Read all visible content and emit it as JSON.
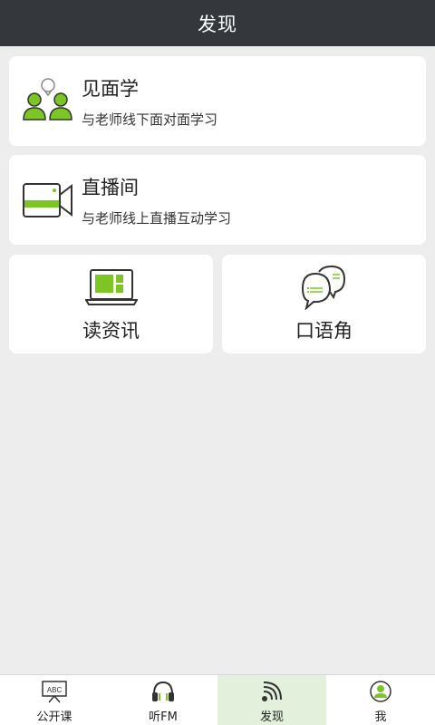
{
  "header": {
    "title": "发现"
  },
  "cards": {
    "meet": {
      "title": "见面学",
      "subtitle": "与老师线下面对面学习",
      "icon": "people-icon"
    },
    "live": {
      "title": "直播间",
      "subtitle": "与老师线上直播互动学习",
      "icon": "video-camera-icon"
    },
    "news": {
      "title": "读资讯",
      "icon": "laptop-icon"
    },
    "oral": {
      "title": "口语角",
      "icon": "chat-bubbles-icon"
    }
  },
  "tabbar": {
    "items": [
      {
        "label": "公开课",
        "icon": "blackboard-icon",
        "icon_text": "ABC"
      },
      {
        "label": "听FM",
        "icon": "headphones-icon"
      },
      {
        "label": "发现",
        "icon": "signal-icon",
        "active": true
      },
      {
        "label": "我",
        "icon": "user-icon"
      }
    ]
  },
  "colors": {
    "accent": "#7cc524",
    "header_bg": "#34373b",
    "active_tab_bg": "#e2f0dc"
  }
}
